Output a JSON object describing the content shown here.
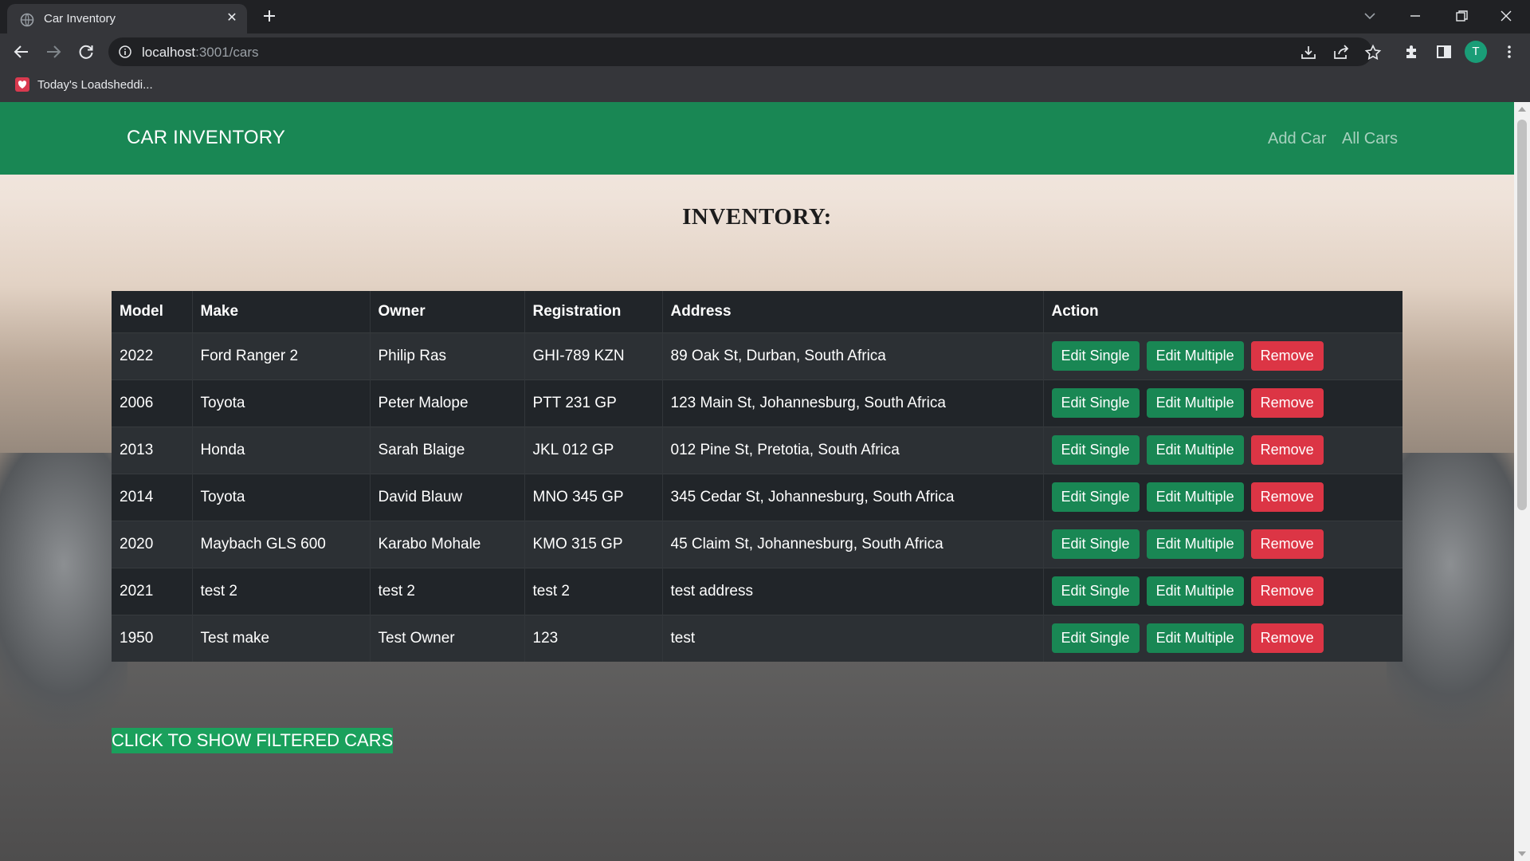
{
  "browser": {
    "tab_title": "Car Inventory",
    "url_host": "localhost",
    "url_path": ":3001/cars",
    "profile_initial": "T",
    "bookmark_label": "Today's Loadsheddi..."
  },
  "navbar": {
    "brand": "CAR INVENTORY",
    "links": [
      "Add Car",
      "All Cars"
    ],
    "color": "#198754"
  },
  "page": {
    "title": "INVENTORY:",
    "filter_button": "CLICK TO SHOW FILTERED CARS"
  },
  "table": {
    "headers": [
      "Model",
      "Make",
      "Owner",
      "Registration",
      "Address",
      "Action"
    ],
    "rows": [
      [
        "2022",
        "Ford Ranger 2",
        "Philip Ras",
        "GHI-789 KZN",
        "89 Oak St, Durban, South Africa"
      ],
      [
        "2006",
        "Toyota",
        "Peter Malope",
        "PTT 231 GP",
        "123 Main St, Johannesburg, South Africa"
      ],
      [
        "2013",
        "Honda",
        "Sarah Blaige",
        "JKL 012 GP",
        "012 Pine St, Pretotia, South Africa"
      ],
      [
        "2014",
        "Toyota",
        "David Blauw",
        "MNO 345 GP",
        "345 Cedar St, Johannesburg, South Africa"
      ],
      [
        "2020",
        "Maybach GLS 600",
        "Karabo Mohale",
        "KMO 315 GP",
        "45 Claim St, Johannesburg, South Africa"
      ],
      [
        "2021",
        "test 2",
        "test 2",
        "test 2",
        "test address"
      ],
      [
        "1950",
        "Test make",
        "Test Owner",
        "123",
        "test"
      ]
    ],
    "actions": {
      "edit_single": "Edit Single",
      "edit_multiple": "Edit Multiple",
      "remove": "Remove"
    }
  },
  "colors": {
    "success": "#198754",
    "danger": "#dc3545",
    "table_dark": "#212529"
  }
}
